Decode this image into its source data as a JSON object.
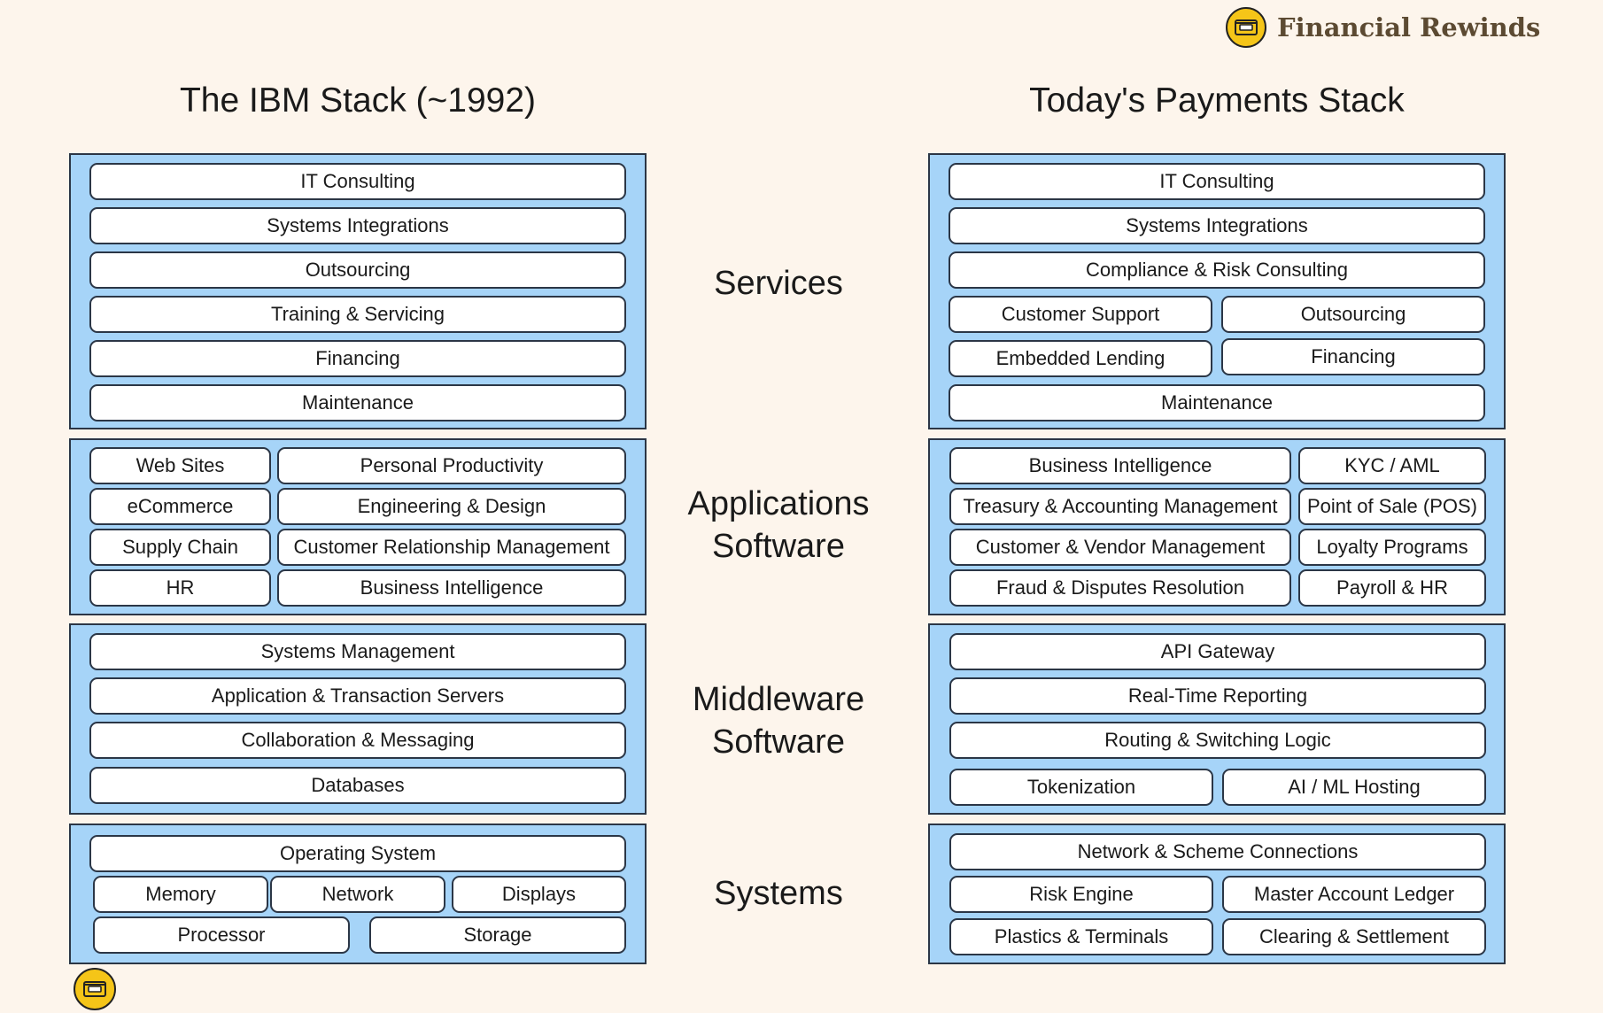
{
  "brand": {
    "name": "Financial Rewinds",
    "logo_icon": "wallet-icon",
    "accent_color": "#f5c518"
  },
  "left_title": "The IBM Stack (~1992)",
  "right_title": "Today's Payments Stack",
  "layer_labels": {
    "services": [
      "Services"
    ],
    "applications": [
      "Applications",
      "Software"
    ],
    "middleware": [
      "Middleware",
      "Software"
    ],
    "systems": [
      "Systems"
    ]
  },
  "ibm": {
    "services": [
      "IT Consulting",
      "Systems Integrations",
      "Outsourcing",
      "Training & Servicing",
      "Financing",
      "Maintenance"
    ],
    "applications": [
      "Web Sites",
      "Personal Productivity",
      "eCommerce",
      "Engineering & Design",
      "Supply Chain",
      "Customer Relationship Management",
      "HR",
      "Business Intelligence"
    ],
    "middleware": [
      "Systems Management",
      "Application & Transaction Servers",
      "Collaboration & Messaging",
      "Databases"
    ],
    "systems": [
      "Operating System",
      "Memory",
      "Network",
      "Displays",
      "Processor",
      "Storage"
    ]
  },
  "payments": {
    "services": [
      "IT Consulting",
      "Systems Integrations",
      "Compliance & Risk Consulting",
      "Customer Support",
      "Outsourcing",
      "Embedded Lending",
      "Financing",
      "Maintenance"
    ],
    "applications": [
      "Business Intelligence",
      "KYC / AML",
      "Treasury & Accounting Management",
      "Point of Sale (POS)",
      "Customer & Vendor Management",
      "Loyalty Programs",
      "Fraud & Disputes Resolution",
      "Payroll & HR"
    ],
    "middleware": [
      "API Gateway",
      "Real-Time Reporting",
      "Routing & Switching Logic",
      "Tokenization",
      "AI / ML Hosting"
    ],
    "systems": [
      "Network & Scheme Connections",
      "Risk Engine",
      "Master Account Ledger",
      "Plastics & Terminals",
      "Clearing & Settlement"
    ]
  },
  "colors": {
    "background": "#fdf5ec",
    "panel": "#a6d4f8",
    "border": "#2b3646",
    "pill": "#ffffff"
  }
}
